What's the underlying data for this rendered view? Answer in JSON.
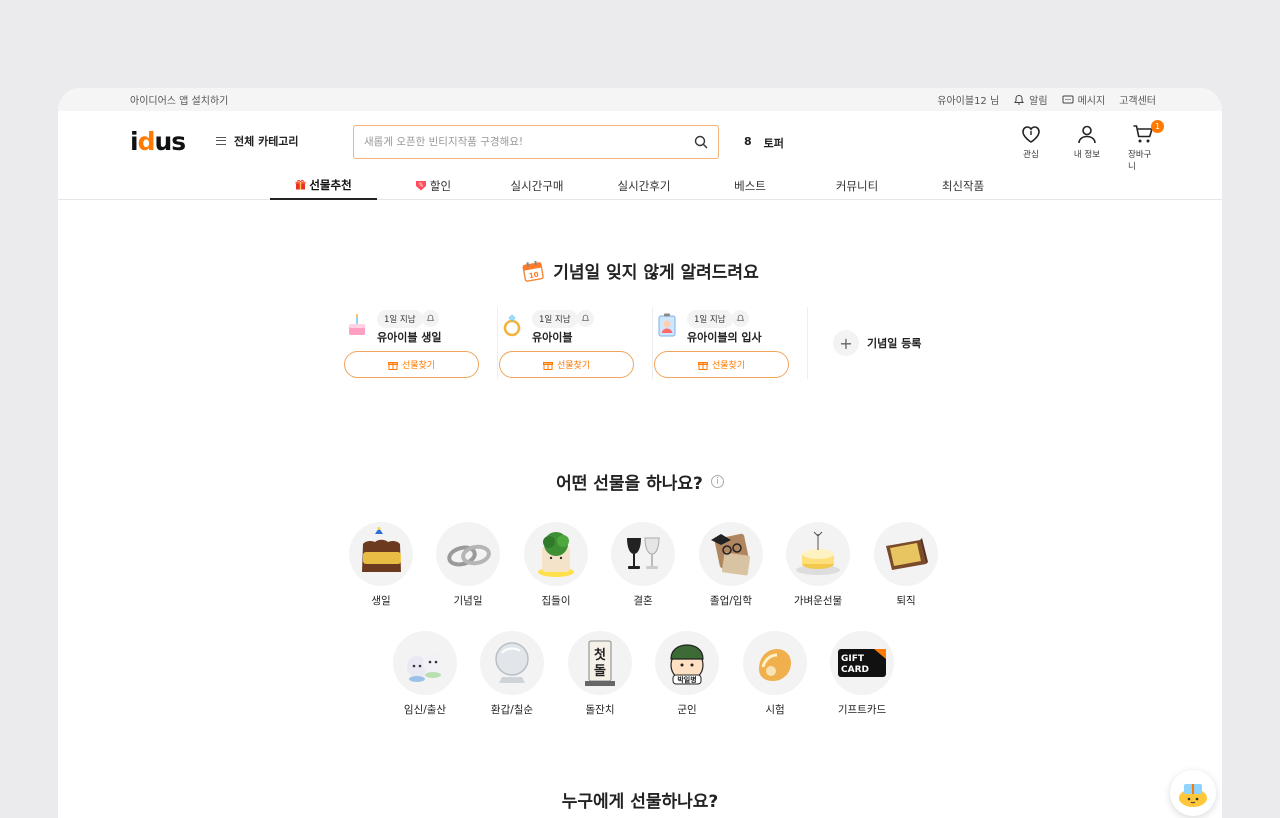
{
  "topbar": {
    "install_app": "아이디어스 앱 설치하기",
    "user_greeting": "유아이블12 님",
    "alerts": "알림",
    "messages": "메시지",
    "support": "고객센터"
  },
  "header": {
    "logo_text_1": "i",
    "logo_text_2": "d",
    "logo_text_3": "us",
    "all_category": "전체 카테고리",
    "search_placeholder": "새롭게 오픈한 빈티지작품 구경해요!",
    "trend_rank": "8",
    "trend_keyword": "토퍼",
    "icons": {
      "wishlist": "관심",
      "my_info": "내 정보",
      "cart": "장바구니",
      "cart_count": "1"
    }
  },
  "nav": {
    "tabs": [
      {
        "label": "선물추천",
        "active": true
      },
      {
        "label": "할인"
      },
      {
        "label": "실시간구매"
      },
      {
        "label": "실시간후기"
      },
      {
        "label": "베스트"
      },
      {
        "label": "커뮤니티"
      },
      {
        "label": "최신작품"
      }
    ]
  },
  "anniversary": {
    "title": "기념일 잊지 않게 알려드려요",
    "calendar_day": "10",
    "cards": [
      {
        "status": "1일 지남",
        "name": "유아이블 생일",
        "button": "선물찾기"
      },
      {
        "status": "1일 지남",
        "name": "유아이블",
        "button": "선물찾기"
      },
      {
        "status": "1일 지남",
        "name": "유아이블의 입사",
        "button": "선물찾기"
      }
    ],
    "add_label": "기념일 등록",
    "add_symbol": "+"
  },
  "gift_types": {
    "title": "어떤 선물을 하나요?",
    "info_symbol": "i",
    "items": [
      {
        "label": "생일",
        "icon": "birthday-cake-icon"
      },
      {
        "label": "기념일",
        "icon": "couple-rings-icon"
      },
      {
        "label": "집들이",
        "icon": "plant-pot-icon"
      },
      {
        "label": "결혼",
        "icon": "wine-glasses-icon"
      },
      {
        "label": "졸업/입학",
        "icon": "graduation-bear-icon"
      },
      {
        "label": "가벼운선물",
        "icon": "cheesecake-icon"
      },
      {
        "label": "퇴직",
        "icon": "gold-plaque-icon"
      },
      {
        "label": "임신/출산",
        "icon": "baby-shoes-icon"
      },
      {
        "label": "환갑/칠순",
        "icon": "crystal-ball-icon"
      },
      {
        "label": "돌잔치",
        "icon": "first-stone-icon"
      },
      {
        "label": "군인",
        "icon": "soldier-icon"
      },
      {
        "label": "시험",
        "icon": "bread-icon"
      },
      {
        "label": "기프트카드",
        "icon": "gift-card-icon"
      }
    ],
    "giftcard_line1": "GIFT",
    "giftcard_line2": "CARD",
    "stone_text_1": "첫",
    "stone_text_2": "돌",
    "soldier_text": "박일병"
  },
  "recipient": {
    "title": "누구에게 선물하나요?"
  },
  "colors": {
    "brand": "#ff7a00",
    "search_border": "#f3b37a"
  }
}
